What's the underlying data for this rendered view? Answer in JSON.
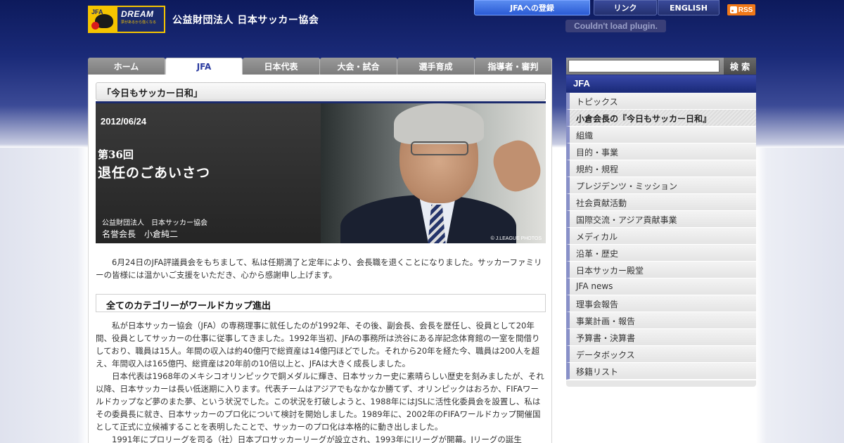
{
  "header": {
    "logo_jfa": "JFA",
    "logo_dream": "DREAM",
    "logo_tagline": "夢があるから強くなる",
    "org_name": "公益財団法人 日本サッカー協会",
    "nav_register": "JFAへの登録",
    "nav_link": "リンク",
    "nav_english": "ENGLISH",
    "rss_label": "RSS",
    "plugin_message": "Couldn't load plugin."
  },
  "tabs": [
    "ホーム",
    "JFA",
    "日本代表",
    "大会・試合",
    "選手育成",
    "指導者・審判"
  ],
  "article": {
    "page_title": "「今日もサッカー日和」",
    "hero_date": "2012/06/24",
    "hero_number": "第36回",
    "hero_title": "退任のごあいさつ",
    "hero_org": "公益財団法人　日本サッカー協会",
    "hero_name": "名誉会長　小倉純二",
    "photo_credit": "© J.LEAGUE PHOTOS",
    "intro": "6月24日のJFA評議員会をもちまして、私は任期満了と定年により、会長職を退くことになりました。サッカーファミリーの皆様には温かいご支援をいただき、心から感謝申し上げます。",
    "section_title": "全てのカテゴリーがワールドカップ進出",
    "para1": "私が日本サッカー協会（JFA）の専務理事に就任したのが1992年、その後、副会長、会長を歴任し、役員として20年間、役員としてサッカーの仕事に従事してきました。1992年当初、JFAの事務所は渋谷にある岸記念体育館の一室を間借りしており、職員は15人。年間の収入は約40億円で総資産は14億円ほどでした。それから20年を経た今、職員は200人を超え、年間収入は165億円、総資産は20年前の10倍以上と、JFAは大きく成長しました。",
    "para2": "日本代表は1968年のメキシコオリンピックで銅メダルに輝き、日本サッカー史に素晴らしい歴史を刻みましたが、それ以降、日本サッカーは長い低迷期に入ります。代表チームはアジアでもなかなか勝てず、オリンピックはおろか、FIFAワールドカップなど夢のまた夢、という状況でした。この状況を打破しようと、1988年にはJSLに活性化委員会を設置し、私はその委員長に就き、日本サッカーのプロ化について検討を開始しました。1989年に、2002年のFIFAワールドカップ開催国として正式に立候補することを表明したことで、サッカーのプロ化は本格的に動き出しました。",
    "para3": "1991年にプロリーグを司る（社）日本プロサッカーリーグが設立され、1993年にJリーグが開幕。Jリーグの誕生"
  },
  "sidebar": {
    "search_button": "検 索",
    "search_placeholder": "",
    "heading": "JFA",
    "items": [
      "トピックス",
      "小倉会長の『今日もサッカー日和』",
      "組織",
      "目的・事業",
      "規約・規程",
      "プレジデンツ・ミッション",
      "社会貢献活動",
      "国際交流・アジア貢献事業",
      "メディカル",
      "沿革・歴史",
      "日本サッカー殿堂",
      "JFA news",
      "理事会報告",
      "事業計画・報告",
      "予算書・決算書",
      "データボックス",
      "移籍リスト"
    ]
  }
}
